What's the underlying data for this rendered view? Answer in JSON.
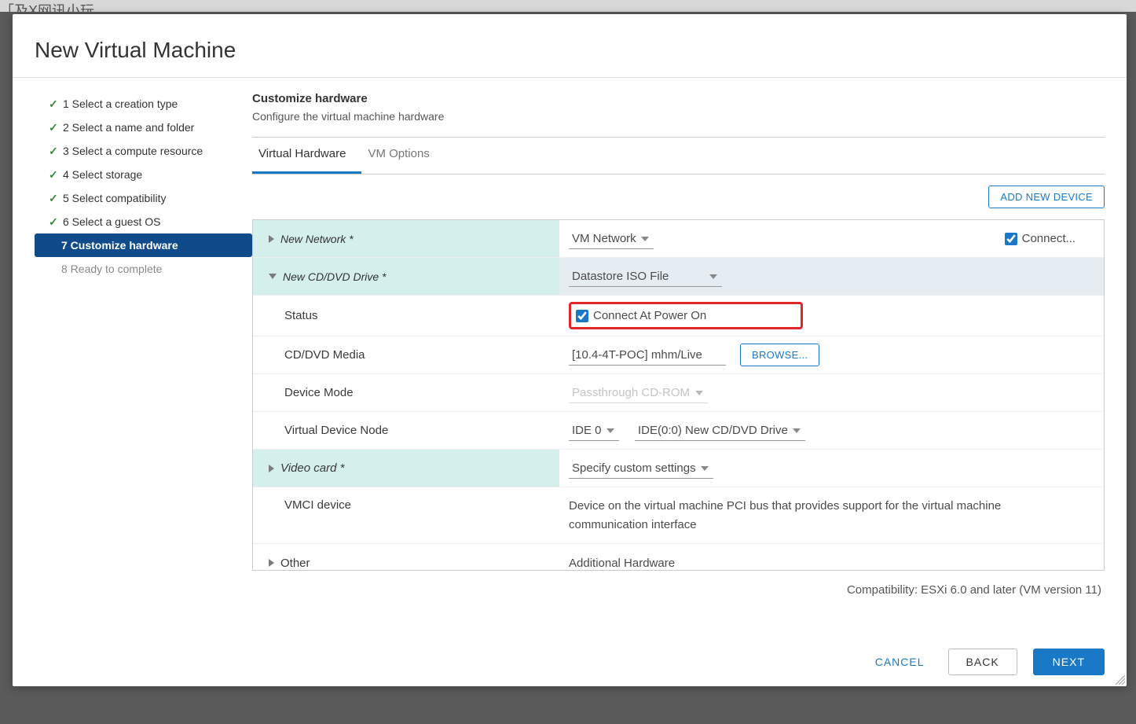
{
  "backdrop": {
    "text": "「及X网讯小玩"
  },
  "dialog": {
    "title": "New Virtual Machine",
    "steps": [
      {
        "label": "1 Select a creation type",
        "state": "done"
      },
      {
        "label": "2 Select a name and folder",
        "state": "done"
      },
      {
        "label": "3 Select a compute resource",
        "state": "done"
      },
      {
        "label": "4 Select storage",
        "state": "done"
      },
      {
        "label": "5 Select compatibility",
        "state": "done"
      },
      {
        "label": "6 Select a guest OS",
        "state": "done"
      },
      {
        "label": "7 Customize hardware",
        "state": "current"
      },
      {
        "label": "8 Ready to complete",
        "state": "disabled"
      }
    ],
    "subhead": "Customize hardware",
    "subdesc": "Configure the virtual machine hardware",
    "tabs": {
      "hw": "Virtual Hardware",
      "options": "VM Options"
    },
    "add_device": "ADD NEW DEVICE",
    "rows": {
      "new_network": {
        "label": "New Network *",
        "value": "VM Network",
        "connect": "Connect..."
      },
      "cd_drive": {
        "label": "New CD/DVD Drive *",
        "value": "Datastore ISO File"
      },
      "status": {
        "label": "Status",
        "cb_label": "Connect At Power On"
      },
      "media": {
        "label": "CD/DVD Media",
        "value": "[10.4-4T-POC] mhm/Live",
        "browse": "BROWSE..."
      },
      "device_mode": {
        "label": "Device Mode",
        "value": "Passthrough CD-ROM"
      },
      "vdn": {
        "label": "Virtual Device Node",
        "bus": "IDE 0",
        "slot": "IDE(0:0) New CD/DVD Drive"
      },
      "video": {
        "label": "Video card *",
        "value": "Specify custom settings"
      },
      "vmci": {
        "label": "VMCI device",
        "desc": "Device on the virtual machine PCI bus that provides support for the virtual machine communication interface"
      },
      "other": {
        "label": "Other",
        "value": "Additional Hardware"
      }
    },
    "compat": "Compatibility: ESXi 6.0 and later (VM version 11)",
    "actions": {
      "cancel": "CANCEL",
      "back": "BACK",
      "next": "NEXT"
    }
  }
}
